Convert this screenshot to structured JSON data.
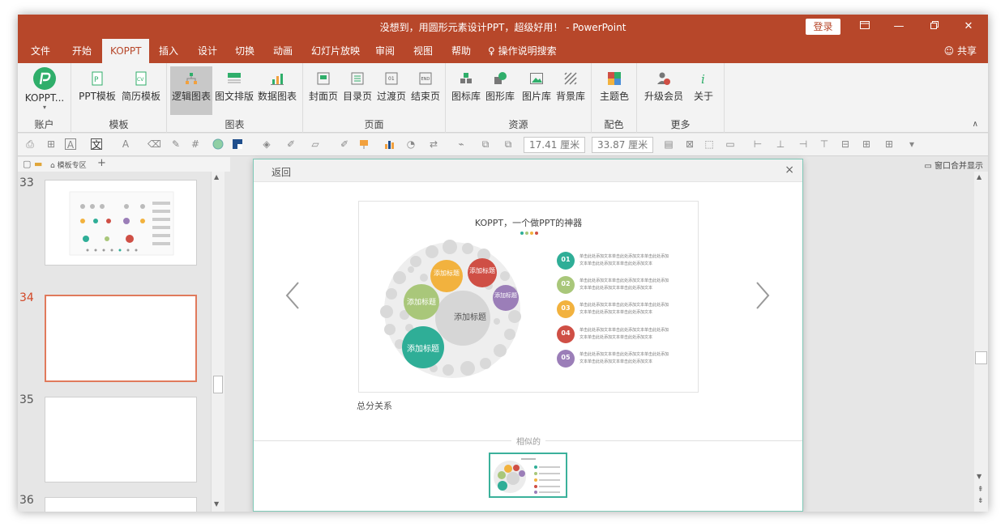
{
  "window": {
    "title": "没想到，用圆形元素设计PPT，超级好用！ - PowerPoint",
    "login_label": "登录",
    "share_label": "共享",
    "controls": [
      "restore-ribbon-icon",
      "minimize-icon",
      "restore-icon",
      "close-icon"
    ]
  },
  "menu": {
    "tabs": [
      "文件",
      "开始",
      "KOPPT",
      "插入",
      "设计",
      "切换",
      "动画",
      "幻灯片放映",
      "审阅",
      "视图",
      "帮助"
    ],
    "active": "KOPPT",
    "search_label": "操作说明搜索"
  },
  "ribbon": {
    "groups": [
      {
        "label": "账户",
        "buttons": [
          "KOPPT..."
        ]
      },
      {
        "label": "模板",
        "buttons": [
          "PPT模板",
          "简历模板"
        ]
      },
      {
        "label": "图表",
        "buttons": [
          "逻辑图表",
          "图文排版",
          "数据图表"
        ]
      },
      {
        "label": "页面",
        "buttons": [
          "封面页",
          "目录页",
          "过渡页",
          "结束页"
        ]
      },
      {
        "label": "资源",
        "buttons": [
          "图标库",
          "图形库",
          "图片库",
          "背景库"
        ]
      },
      {
        "label": "配色",
        "buttons": [
          "主题色"
        ]
      },
      {
        "label": "更多",
        "buttons": [
          "升级会员",
          "关于"
        ]
      }
    ],
    "active_button": "逻辑图表"
  },
  "qat": {
    "width_value": "17.41 厘米",
    "height_value": "33.87 厘米"
  },
  "thumbpanel": {
    "header_label": "模板专区",
    "slide_numbers": [
      "33",
      "34",
      "35",
      "36"
    ],
    "selected": "34"
  },
  "right_label": "窗口合并显示",
  "dialog": {
    "back_label": "返回",
    "close_label": "×",
    "preview_title": "KOPPT，一个做PPT的神器",
    "center_label": "添加标题",
    "bubble_labels": [
      "添加标题",
      "添加标题",
      "添加标题",
      "添加标题",
      "添加标题"
    ],
    "list": [
      {
        "num": "01",
        "color": "#2fae97",
        "line1": "单击此处添加文本单击此处添加文本单击此处添加",
        "line2": "文本单击此处添加文本单击此处添加文本"
      },
      {
        "num": "02",
        "color": "#a9c77a",
        "line1": "单击此处添加文本单击此处添加文本单击此处添加",
        "line2": "文本单击此处添加文本单击此处添加文本"
      },
      {
        "num": "03",
        "color": "#f2b23e",
        "line1": "单击此处添加文本单击此处添加文本单击此处添加",
        "line2": "文本单击此处添加文本单击此处添加文本"
      },
      {
        "num": "04",
        "color": "#cf4f45",
        "line1": "单击此处添加文本单击此处添加文本单击此处添加",
        "line2": "文本单击此处添加文本单击此处添加文本"
      },
      {
        "num": "05",
        "color": "#9b7eb8",
        "line1": "单击此处添加文本单击此处添加文本单击此处添加",
        "line2": "文本单击此处添加文本单击此处添加文本"
      }
    ],
    "template_name": "总分关系",
    "similar_label": "相似的"
  },
  "colors": {
    "brand": "#b7472a",
    "teal": "#2fae97",
    "green": "#a9c77a",
    "orange": "#f2b23e",
    "red": "#cf4f45",
    "purple": "#9b7eb8"
  }
}
